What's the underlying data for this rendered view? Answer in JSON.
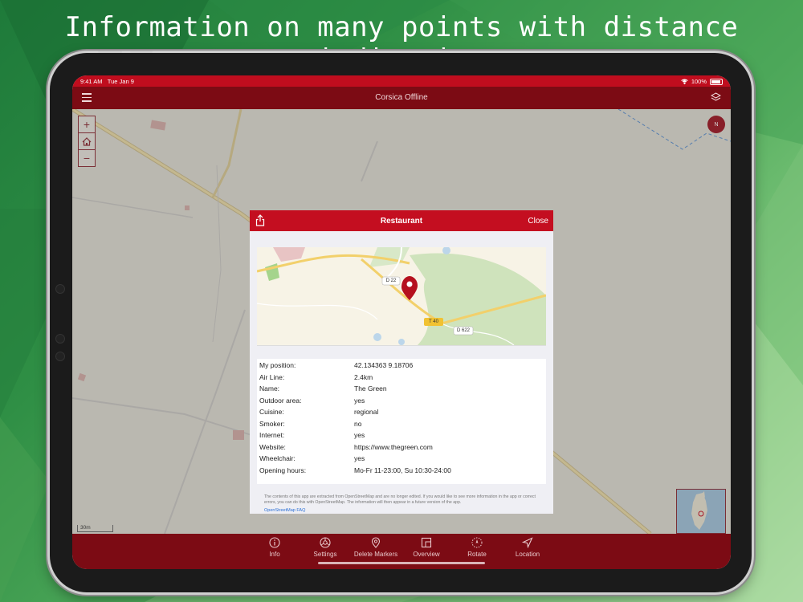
{
  "headline": "Information on many points with distance indication",
  "status": {
    "time": "9:41 AM",
    "date": "Tue Jan 9",
    "battery": "100%"
  },
  "app": {
    "title": "Corsica Offline"
  },
  "map": {
    "scale_label": "30m",
    "compass_label": "N"
  },
  "modal": {
    "title": "Restaurant",
    "close_label": "Close",
    "map_labels": {
      "road1": "D 22",
      "road2": "T 40",
      "road3": "D 622"
    },
    "rows": [
      {
        "key": "My position:",
        "value": "42.134363 9.18706"
      },
      {
        "key": "Air Line:",
        "value": "2.4km"
      },
      {
        "key": "Name:",
        "value": "The Green"
      },
      {
        "key": "Outdoor area:",
        "value": "yes"
      },
      {
        "key": "Cuisine:",
        "value": "regional"
      },
      {
        "key": "Smoker:",
        "value": "no"
      },
      {
        "key": "Internet:",
        "value": "yes"
      },
      {
        "key": "Website:",
        "value": "https://www.thegreen.com"
      },
      {
        "key": "Wheelchair:",
        "value": "yes"
      },
      {
        "key": "Opening hours:",
        "value": "Mo-Fr 11-23:00, Su 10:30-24:00"
      }
    ],
    "footer_text": "The contents of this app are extracted from OpenStreetMap and are no longer edited. If you would like to see more information in the app or correct errors, you can do this with OpenStreetMap. The information will then appear in a future version of the app.",
    "footer_link": "OpenStreetMap FAQ"
  },
  "tabs": [
    {
      "label": "Info",
      "icon": "info-icon"
    },
    {
      "label": "Settings",
      "icon": "settings-icon"
    },
    {
      "label": "Delete Markers",
      "icon": "marker-icon"
    },
    {
      "label": "Overview",
      "icon": "overview-icon"
    },
    {
      "label": "Rotate",
      "icon": "rotate-icon"
    },
    {
      "label": "Location",
      "icon": "location-icon"
    }
  ],
  "colors": {
    "bar": "#7c0b14",
    "accent": "#c40e20"
  }
}
